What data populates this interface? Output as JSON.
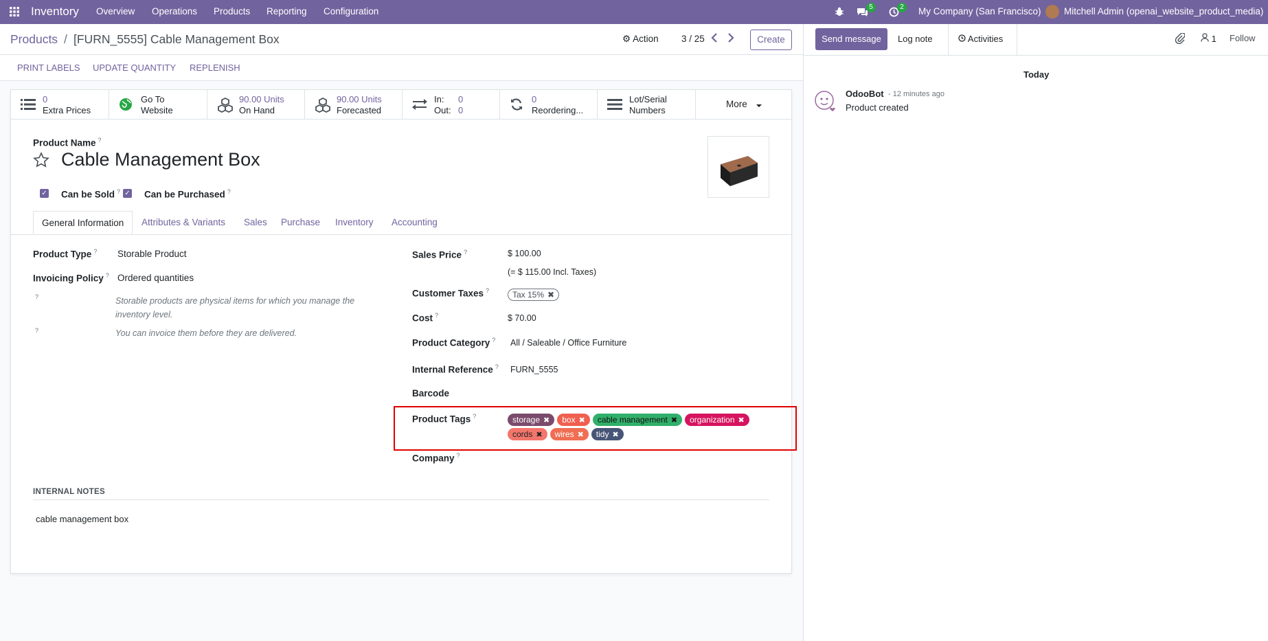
{
  "nav": {
    "app_name": "Inventory",
    "menu": [
      "Overview",
      "Operations",
      "Products",
      "Reporting",
      "Configuration"
    ],
    "chat_count": "5",
    "activity_count": "2",
    "company": "My Company (San Francisco)",
    "user": "Mitchell Admin (openai_website_product_media)"
  },
  "control": {
    "breadcrumb_root": "Products",
    "breadcrumb_sep": "/",
    "breadcrumb_current": "[FURN_5555] Cable Management Box",
    "action_label": "Action",
    "pager": "3 / 25",
    "create_label": "Create"
  },
  "statusbar": {
    "print_labels": "PRINT LABELS",
    "update_quantity": "UPDATE QUANTITY",
    "replenish": "REPLENISH"
  },
  "smart_buttons": [
    {
      "line1": "0",
      "line2": "Extra Prices",
      "icon": "list-icon"
    },
    {
      "line1": "Go To",
      "line2": "Website",
      "icon": "globe-icon"
    },
    {
      "line1": "90.00 Units",
      "line2": "On Hand",
      "icon": "cubes-icon"
    },
    {
      "line1": "90.00 Units",
      "line2": "Forecasted",
      "icon": "cubes-icon"
    },
    {
      "line1": "In:",
      "line1_val": "0",
      "line2": "Out:",
      "line2_val": "0",
      "icon": "exchange-icon"
    },
    {
      "line1": "0",
      "line2": "Reordering...",
      "icon": "refresh-icon"
    },
    {
      "line1": "Lot/Serial",
      "line2": "Numbers",
      "icon": "bars-icon"
    },
    {
      "line1": "More",
      "icon": "caret-down-icon"
    }
  ],
  "product": {
    "name_label": "Product Name",
    "name": "Cable Management Box",
    "can_be_sold": "Can be Sold",
    "can_be_purchased": "Can be Purchased"
  },
  "tabs": [
    "General Information",
    "Attributes & Variants",
    "Sales",
    "Purchase",
    "Inventory",
    "Accounting"
  ],
  "general": {
    "product_type_label": "Product Type",
    "product_type": "Storable Product",
    "invoicing_policy_label": "Invoicing Policy",
    "invoicing_policy": "Ordered quantities",
    "help_storable": "Storable products are physical items for which you manage the inventory level.",
    "help_invoice": "You can invoice them before they are delivered.",
    "sales_price_label": "Sales Price",
    "sales_price": "$ 100.00",
    "sales_price_incl": "(= $ 115.00 Incl. Taxes)",
    "customer_taxes_label": "Customer Taxes",
    "customer_tax_tag": "Tax 15%",
    "cost_label": "Cost",
    "cost": "$ 70.00",
    "category_label": "Product Category",
    "category": "All / Saleable / Office Furniture",
    "internal_ref_label": "Internal Reference",
    "internal_ref": "FURN_5555",
    "barcode_label": "Barcode",
    "product_tags_label": "Product Tags",
    "company_label": "Company"
  },
  "product_tags": [
    {
      "label": "storage",
      "color": "#7a4b6c"
    },
    {
      "label": "box",
      "color": "#f06050"
    },
    {
      "label": "cable management",
      "color": "#30b06a"
    },
    {
      "label": "organization",
      "color": "#d6145f"
    },
    {
      "label": "cords",
      "color": "#f3756c"
    },
    {
      "label": "wires",
      "color": "#f06e53"
    },
    {
      "label": "tidy",
      "color": "#475577"
    }
  ],
  "notes": {
    "header": "INTERNAL NOTES",
    "content": "cable management box"
  },
  "chatter": {
    "send_message": "Send message",
    "log_note": "Log note",
    "activities": "Activities",
    "followers_count": "1",
    "follow": "Follow",
    "date_separator": "Today",
    "message_author": "OdooBot",
    "message_time": "- 12 minutes ago",
    "message_body": "Product created"
  },
  "colors": {
    "brand": "#71639e",
    "highlight": "#e00000"
  }
}
